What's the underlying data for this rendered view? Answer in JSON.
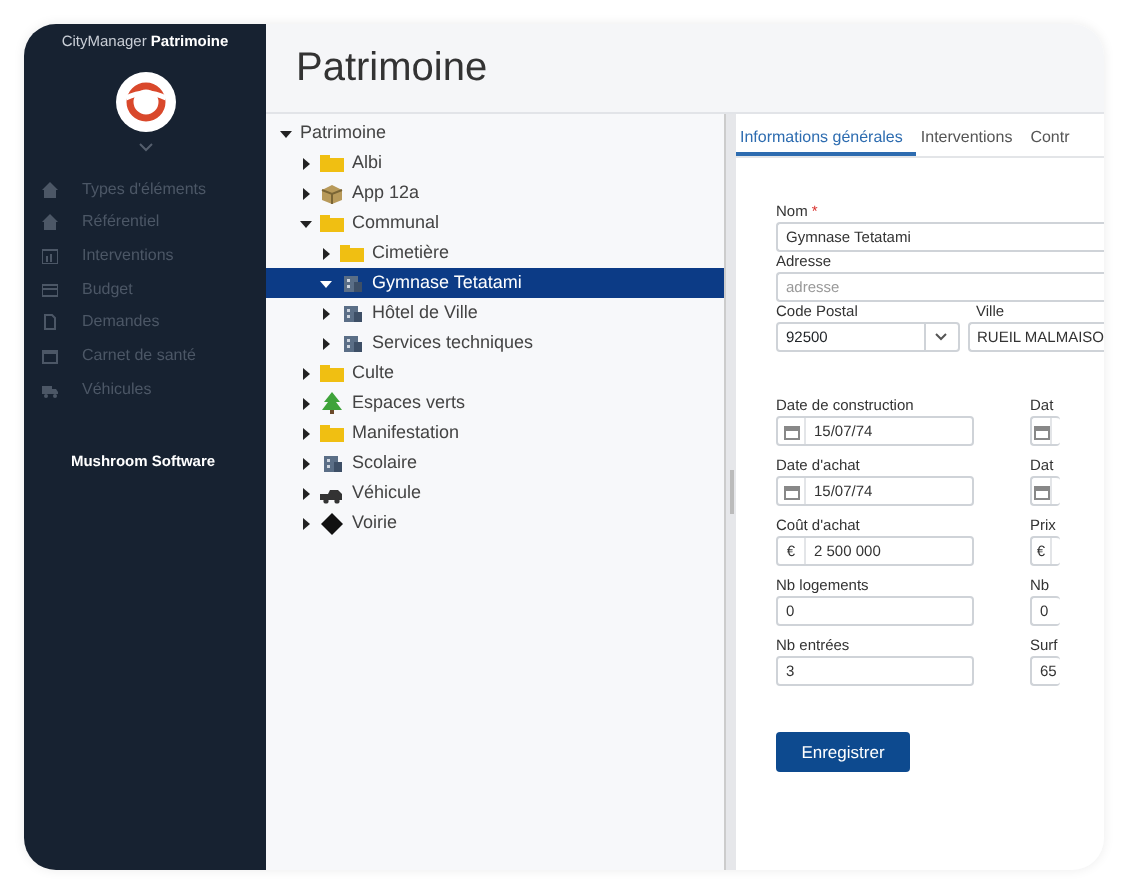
{
  "sidebar": {
    "brand": "CityManager **Patrimoine**",
    "items": [
      {
        "label": "Types d'éléments"
      },
      {
        "label": "Référentiel"
      },
      {
        "label": "Interventions"
      },
      {
        "label": "Budget"
      },
      {
        "label": "Demandes"
      },
      {
        "label": "Carnet de santé"
      },
      {
        "label": "Véhicules"
      }
    ],
    "footer": "Mushroom Software"
  },
  "header": {
    "title": "Patrimoine"
  },
  "tree": [
    {
      "label": "Patrimoine",
      "expanded": true,
      "selected": false,
      "children": [
        {
          "label": "Albi",
          "kind": "folder",
          "expanded": false,
          "selected": false
        },
        {
          "label": "App 12a",
          "kind": "package",
          "expanded": false,
          "selected": false
        },
        {
          "label": "Communal",
          "kind": "folder",
          "expanded": true,
          "selected": false,
          "children": [
            {
              "label": "Cimetière",
              "kind": "folder",
              "expanded": false,
              "selected": false
            },
            {
              "label": "Gymnase Tetatami",
              "kind": "building",
              "expanded": true,
              "selected": true
            },
            {
              "label": "Hôtel de Ville",
              "kind": "building",
              "expanded": false,
              "selected": false
            },
            {
              "label": "Services techniques",
              "kind": "building",
              "expanded": false,
              "selected": false
            }
          ]
        },
        {
          "label": "Culte",
          "kind": "folder",
          "expanded": false,
          "selected": false
        },
        {
          "label": "Espaces verts",
          "kind": "tree",
          "expanded": false,
          "selected": false
        },
        {
          "label": "Manifestation",
          "kind": "folder",
          "expanded": false,
          "selected": false
        },
        {
          "label": "Scolaire",
          "kind": "building",
          "expanded": false,
          "selected": false
        },
        {
          "label": "Véhicule",
          "kind": "vehicle",
          "expanded": false,
          "selected": false
        },
        {
          "label": "Voirie",
          "kind": "sign",
          "expanded": false,
          "selected": false
        }
      ]
    }
  ],
  "tabs": [
    {
      "label": "Informations générales",
      "selected": true
    },
    {
      "label": "Interventions",
      "selected": false
    },
    {
      "label": "Contr",
      "selected": false
    }
  ],
  "form": {
    "nom": {
      "label": "Nom",
      "required_mark": "*",
      "value": "Gymnase Tetatami"
    },
    "adresse": {
      "label": "Adresse",
      "placeholder": "adresse"
    },
    "code_postal": {
      "label": "Code Postal",
      "value": "92500"
    },
    "ville": {
      "label": "Ville",
      "value": "RUEIL MALMAISO"
    },
    "details": [
      {
        "label": "Date de construction",
        "kind": "date",
        "value": "15/07/74"
      },
      {
        "label": "Dat",
        "kind": "date"
      },
      {
        "label": "Date d'achat",
        "kind": "date",
        "value": "15/07/74"
      },
      {
        "label": "Dat",
        "kind": "date"
      },
      {
        "label": "Coût d'achat",
        "kind": "money",
        "prefix": "€",
        "value": "2 500 000"
      },
      {
        "label": "Prix",
        "kind": "money",
        "prefix": "€"
      },
      {
        "label": "Nb logements",
        "kind": "text",
        "value": "0"
      },
      {
        "label": "Nb",
        "kind": "text",
        "value": "0"
      },
      {
        "label": "Nb entrées",
        "kind": "text",
        "value": "3"
      },
      {
        "label": "Surf",
        "kind": "text",
        "value": "65"
      }
    ]
  },
  "save_button": "Enregistrer"
}
